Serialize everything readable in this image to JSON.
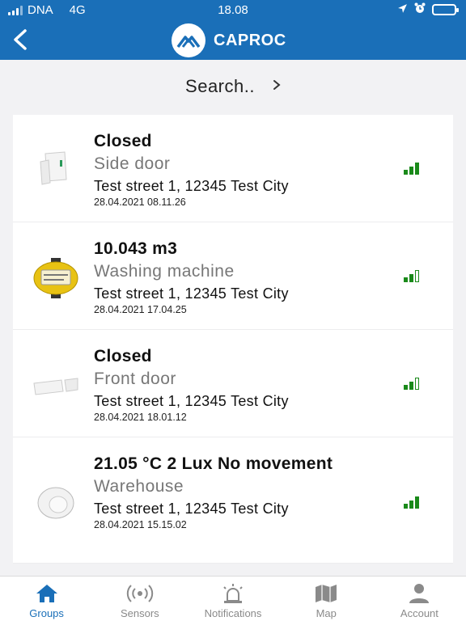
{
  "statusbar": {
    "carrier": "DNA",
    "network": "4G",
    "time": "18.08"
  },
  "header": {
    "brand": "CAPROC"
  },
  "search": {
    "label": "Search..",
    "chevron": "›"
  },
  "devices": [
    {
      "status": "Closed",
      "name": "Side door",
      "address": "Test street 1, 12345 Test City",
      "timestamp": "28.04.2021 08.11.26",
      "signal_bars": 3,
      "icon": "door-sensor-icon"
    },
    {
      "status": "10.043 m3",
      "name": "Washing machine",
      "address": "Test street 1, 12345 Test City",
      "timestamp": "28.04.2021 17.04.25",
      "signal_bars": 2,
      "icon": "water-meter-icon"
    },
    {
      "status": "Closed",
      "name": "Front door",
      "address": "Test street 1, 12345 Test City",
      "timestamp": "28.04.2021 18.01.12",
      "signal_bars": 2,
      "icon": "magnetic-contact-icon"
    },
    {
      "status": "21.05 °C 2 Lux No movement",
      "name": "Warehouse",
      "address": "Test street 1, 12345 Test City",
      "timestamp": "28.04.2021 15.15.02",
      "signal_bars": 3,
      "icon": "motion-sensor-icon"
    }
  ],
  "tabs": [
    {
      "label": "Groups",
      "icon": "home-icon",
      "active": true
    },
    {
      "label": "Sensors",
      "icon": "sensors-icon",
      "active": false
    },
    {
      "label": "Notifications",
      "icon": "alarm-light-icon",
      "active": false
    },
    {
      "label": "Map",
      "icon": "map-icon",
      "active": false
    },
    {
      "label": "Account",
      "icon": "person-icon",
      "active": false
    }
  ],
  "colors": {
    "brand_blue": "#1a6fb8",
    "signal_green": "#1a8a1a",
    "inactive_gray": "#8a8a8a"
  }
}
